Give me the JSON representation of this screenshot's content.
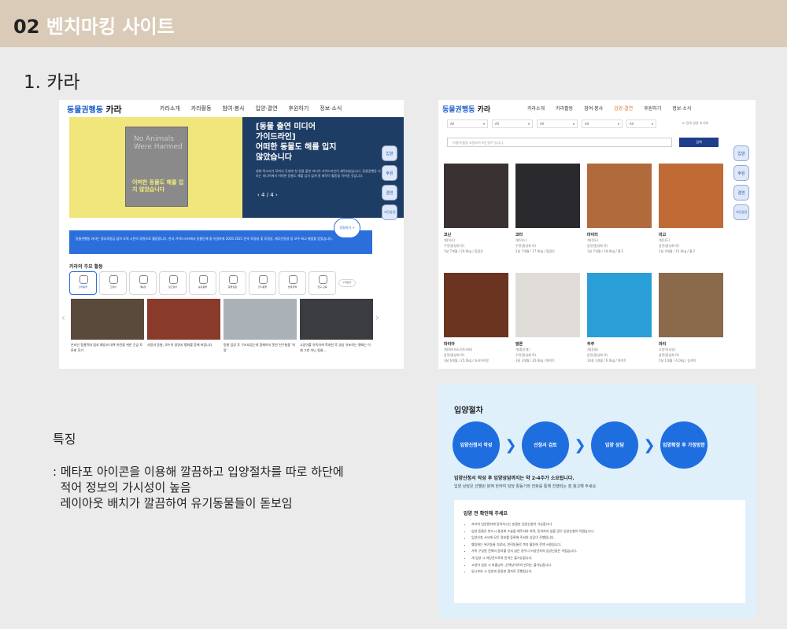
{
  "header": {
    "number": "02",
    "title": "벤치마킹 사이트"
  },
  "site": {
    "name": "1. 카라"
  },
  "screens": {
    "home": {
      "logo_text": "동물권행동",
      "logo_bold": "카라",
      "menu": [
        "카라소개",
        "카라활동",
        "참여·봉사",
        "입양·결연",
        "후원하기",
        "정보·소식"
      ],
      "poster_en": "No Animals Were Harmed",
      "poster_ko": "어떠한 동물도 해를 입지 않았습니다",
      "hero_title_line1": "[동물 출연 미디어",
      "hero_title_line2": "가이드라인]",
      "hero_title_line3": "어떠한 동물도 해를 입지",
      "hero_title_line4": "않았습니다",
      "hero_desc": "영화·목소리가 모여서 국내에 첫 동물 출연 미디어 가이드라인이 제작되었습니다. 동물권행동 카라는 미디어에서 어떠한 동물도 해를 입지 않게 잘 제작이 활동을 이어갈 것입니다.",
      "hero_pager": "4 / 4",
      "side_icons": [
        "입양",
        "후원",
        "결연",
        "고민상담"
      ],
      "notice": "동물권행동 카라는 정부후원금 없이 오직 시민의 후원으로 활동합니다. 한국 가이드스타에서 동물단체 중 유일하게 2020 2021 연속 투명성 및 후원성, 재무안정성 등 모두 최고 별점을 받았습니다.",
      "donate_btn": "후원하기 →",
      "activities_title": "카라의 주요 활동",
      "activities": [
        "반려동물",
        "고양이",
        "개농장",
        "길고양이",
        "농장동물",
        "동물실험",
        "전시동물",
        "법과정책",
        "연구·교육"
      ],
      "activities_more": "+더보기",
      "news": [
        {
          "text": "온라인 동물학대 범죄 예방과 대책 마련을 위한 긴급 토론회 후기",
          "color": "#5a4a3c"
        },
        {
          "text": "사람과 동물, 모두의 생명과 평화를 함께 바랍니다",
          "color": "#8a3a2a"
        },
        {
          "text": "동물 입양 후 구조되었는데 함께하지 못한 친구들을 '희망'",
          "color": "#aab2b8"
        },
        {
          "text": "고양이를 유독하게 학대한 후 영상 유포하는 행태는 이제 그만 아닌 동물...",
          "color": "#3b3c40"
        }
      ]
    },
    "adoption": {
      "logo_text": "동물권행동",
      "logo_bold": "카라",
      "menu": [
        "카라소개",
        "카라활동",
        "참여·봉사",
        "입양·결연",
        "후원하기",
        "정보·소식"
      ],
      "active_menu": "입양·결연",
      "filters": [
        "All",
        "All",
        "All",
        "All",
        "All",
        "All"
      ],
      "reset": "⟳ 검색 설정 초기화",
      "search_placeholder": "이름/이름을 포함되어 버는경우 입니다.",
      "search_btn": "검색",
      "side_icons": [
        "입양",
        "후원",
        "결연",
        "고민상담"
      ],
      "animals": [
        {
          "name": "코난",
          "info1": "개(믹스)",
          "info2": "수컷(중성화 O)",
          "info3": "1살 7개월 / 24.0kg / 흰검은",
          "color": "#3a3232"
        },
        {
          "name": "코타",
          "info1": "개(믹스)",
          "info2": "수컷(중성화 O)",
          "info3": "2살 7개월 / 17.0kg / 흰검은",
          "color": "#2a2a2e"
        },
        {
          "name": "마이티",
          "info1": "개(진도)",
          "info2": "암컷(중성화 O)",
          "info3": "1살 7개월 / 18.0kg / 황구",
          "color": "#b06a3c"
        },
        {
          "name": "마고",
          "info1": "개(진도)",
          "info2": "암컷(중성화 O)",
          "info3": "2살 4개월 / 15.0kg / 황구",
          "color": "#c06a36"
        },
        {
          "name": "마리아",
          "info1": "개(래브라도리트리버)",
          "info2": "암컷(중성화 O)",
          "info3": "3살 6개월 / 25.0kg / 초코브라운",
          "color": "#6a3420"
        },
        {
          "name": "말론",
          "info1": "개(풍산개)",
          "info2": "수컷(중성화 O)",
          "info3": "3살 3개월 / 20.4kg / 화이트",
          "color": "#e0ddd8"
        },
        {
          "name": "주주",
          "info1": "개(푸들)",
          "info2": "암컷(중성화 O)",
          "info3": "10살 1개월 / 6.0kg / 화이트",
          "color": "#2a9ed6"
        },
        {
          "name": "마리",
          "info1": "고양이(코숏)",
          "info2": "암컷(중성화 O)",
          "info3": "5살 1개월 / 4.0kg / 삼색이",
          "color": "#8a6a4a"
        }
      ]
    },
    "process": {
      "title": "입양절차",
      "steps": [
        "입양신청서 작성",
        "선정서 검토",
        "입양 상담",
        "입양확정 후 가정방문"
      ],
      "note1": "입양신청서 작성 후 입양상담까지는 약 2-4주가 소요됩니다.",
      "note2": "입양 상담은 선별된 분께 한하여 담당 활동가와 전화를 통해 진행되는 점 참고해 주세요.",
      "check_title": "입양 전 확인해 주세요",
      "checks": [
        "카라의 입양원칙에 동의하시는 분들만 입양신청이 가능합니다.",
        "입양 동물은 반드시 중성화 수술을 해주셔야 하며, 동의하지 않을 경우 입양신청이 어렵습니다.",
        "입양신청 서식에 모든 정보를 등록해 주셔야 상담이 진행됩니다.",
        "했음에는 위기동물 치료비, 반려동물로 복지 활동에 전액 사용됩니다.",
        "가족 구성원 전체의 동의를 얻지 않은 경우나 미성년자의 입양신청은 어렵습니다.",
        "개 입양 시 마당견으로의 반려는 불가능합니다.",
        "고양이 입양 시 외출냥이, 산책냥이로의 반려는 불가능합니다.",
        "임시보호 시 입양과 동일한 절차로 진행됩니다."
      ]
    }
  },
  "features": {
    "title": "특징",
    "line1": ": 메타포 아이콘을 이용해 깔끔하고  입양절차를 따로 하단에",
    "line2": "  적어 정보의 가시성이 높음",
    "line3": "  레이아웃 배치가 깔끔하여 유기동물들이 돋보임"
  }
}
